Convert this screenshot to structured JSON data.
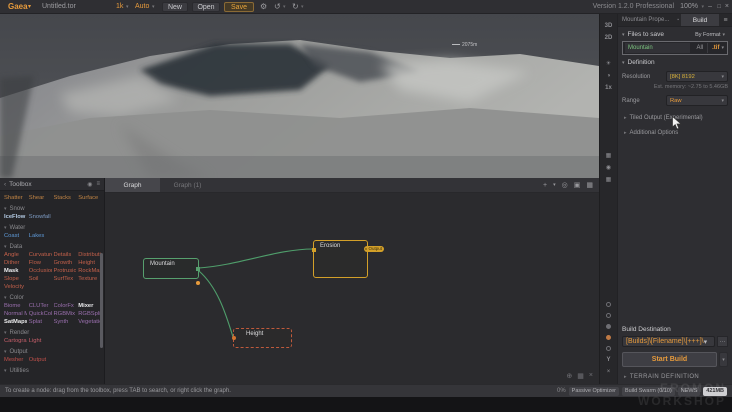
{
  "colors": {
    "accent": "#e79b3c",
    "node_green": "#57a06e",
    "node_yellow": "#d3a029",
    "node_red": "#bf5a3c",
    "link_green": "#4f9e6b",
    "save_value_green": "#7cc47f"
  },
  "icons": {
    "dropdown": "▾",
    "collapse": "▾",
    "expand": "▸",
    "gear": "⚙",
    "undo": "↺",
    "redo": "↻",
    "minimize": "–",
    "maximize": "□",
    "close": "×",
    "menu": "≡",
    "eye": "◉",
    "back": "‹",
    "plus": "+",
    "target": "◎",
    "lock": "▣",
    "screen": "▦",
    "sun": "☀",
    "contrast": "◑",
    "fit": "⊕",
    "grid": "▦",
    "cross": "×",
    "browse": "…",
    "pin": "▪"
  },
  "titlebar": {
    "logo": "Gaea",
    "filename": "Untitled.tor",
    "resolution": "1k",
    "build_mode": "Auto",
    "new": "New",
    "open": "Open",
    "save": "Save",
    "version": "Version 1.2.0 Professional",
    "zoom": "100%"
  },
  "viewport": {
    "altitude_marker": "2075m"
  },
  "right_toolbar": {
    "view3d": "3D",
    "view2d": "2D",
    "multiplier": "1x",
    "axis_y": "Y"
  },
  "graph": {
    "tabs": [
      {
        "label": "Graph"
      },
      {
        "label": "Graph (1)"
      }
    ],
    "nodes": [
      {
        "label": "Mountain"
      },
      {
        "label": "Erosion",
        "badge": "Output"
      },
      {
        "label": "Height"
      }
    ]
  },
  "toolbox": {
    "title": "Toolbox",
    "top_items": [
      "Shatter",
      "Shear",
      "Stacks",
      "Surface"
    ],
    "sections": [
      {
        "name": "Snow",
        "items": [
          "IceFlow",
          "Snowfall"
        ]
      },
      {
        "name": "Water",
        "items": [
          "Coast",
          "Lakes"
        ]
      },
      {
        "name": "Data",
        "items": [
          "Angle",
          "Curvature",
          "Details",
          "Distribution",
          "Dither",
          "Flow",
          "Growth",
          "Height",
          "Mask",
          "Occlusion",
          "Protrusion",
          "RockMap",
          "Slope",
          "Soil",
          "SurfTex",
          "Texture",
          "Velocity"
        ]
      },
      {
        "name": "Color",
        "items": [
          "Biome",
          "CLUTer",
          "ColorFx",
          "Mixer",
          "Normal Map",
          "QuickColor",
          "RGBMix",
          "RGBSplit",
          "SatMaps",
          "Splat",
          "Synth",
          "Vegetation"
        ]
      },
      {
        "name": "Render",
        "items": [
          "Cartogra...",
          "Light"
        ]
      },
      {
        "name": "Output",
        "items": [
          "Mesher",
          "Output"
        ]
      },
      {
        "name": "Utilities",
        "items": []
      }
    ]
  },
  "build_panel": {
    "tabs": {
      "properties": "Mountain Prope...",
      "build": "Build"
    },
    "files_to_save": {
      "title": "Files to save",
      "by_format": "By Format",
      "row": {
        "name": "Mountain",
        "scope": "All",
        "format": ".tif"
      }
    },
    "definition": {
      "title": "Definition",
      "resolution_label": "Resolution",
      "resolution_value": "[8K] 8192",
      "memory_note": "Est. memory: ~2.75 to 5.46GB",
      "range_label": "Range",
      "range_value": "Raw"
    },
    "collapsed_sections": [
      "Tiled Output (Experimental)",
      "Additional Options"
    ],
    "build_destination_label": "Build Destination",
    "build_destination_value": "[Builds]\\[Filename]\\[+++]\\",
    "start_build": "Start Build",
    "terrain_definition": "TERRAIN DEFINITION"
  },
  "statusbar": {
    "hint": "To create a node: drag from the toolbox, press TAB to search, or right click the graph.",
    "cpu": "0%",
    "badges": [
      "Passive Optimizer",
      "Build Swarm (0/10)",
      "NEWS",
      "421MB"
    ]
  },
  "watermark": {
    "line1": "EROMON",
    "line2": "WORKSHOP"
  }
}
